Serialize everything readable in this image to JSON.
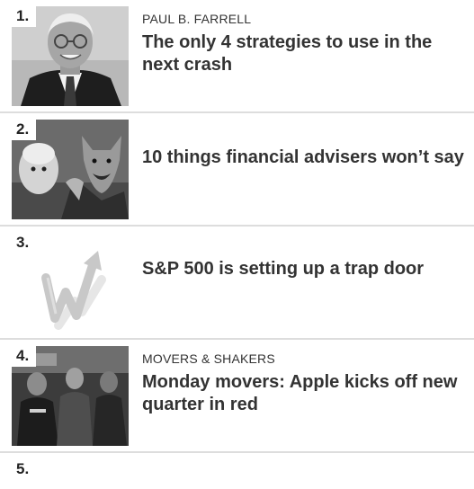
{
  "items": [
    {
      "rank": "1.",
      "kicker": "PAUL B. FARRELL",
      "headline": "The only 4 strategies to use in the next crash",
      "thumb": "portrait-photo"
    },
    {
      "rank": "2.",
      "kicker": "",
      "headline": "10 things financial advisers won’t say",
      "thumb": "wolf-in-sheeps-clothing-photo"
    },
    {
      "rank": "3.",
      "kicker": "",
      "headline": "S&P 500 is setting up a trap door",
      "thumb": "rising-arrow-graphic"
    },
    {
      "rank": "4.",
      "kicker": "MOVERS & SHAKERS",
      "headline": "Monday movers: Apple kicks off new quarter in red",
      "thumb": "trading-floor-photo"
    },
    {
      "rank": "5."
    }
  ]
}
